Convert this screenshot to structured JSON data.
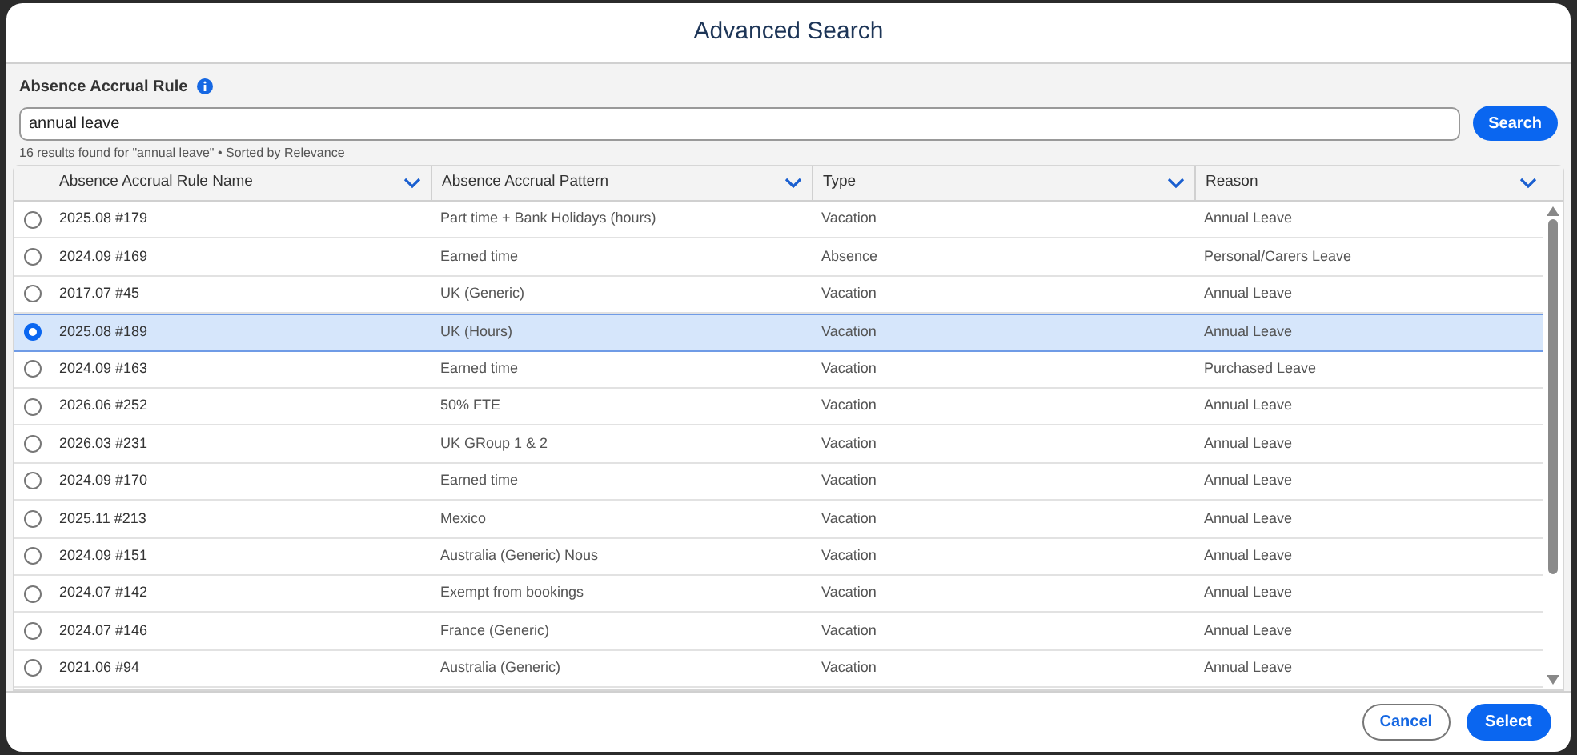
{
  "dialog": {
    "title": "Advanced Search"
  },
  "search": {
    "label": "Absence Accrual Rule",
    "value": "annual leave",
    "button": "Search",
    "summary": "16 results found for \"annual leave\" • Sorted by Relevance"
  },
  "table": {
    "columns": [
      "Absence Accrual Rule Name",
      "Absence Accrual Pattern",
      "Type",
      "Reason"
    ],
    "rows": [
      {
        "selected": false,
        "cells": [
          "2025.08 #179",
          "Part time + Bank Holidays (hours)",
          "Vacation",
          "Annual Leave"
        ]
      },
      {
        "selected": false,
        "cells": [
          "2024.09 #169",
          "Earned time",
          "Absence",
          "Personal/Carers Leave"
        ]
      },
      {
        "selected": false,
        "cells": [
          "2017.07 #45",
          "UK (Generic)",
          "Vacation",
          "Annual Leave"
        ]
      },
      {
        "selected": true,
        "cells": [
          "2025.08 #189",
          "UK (Hours)",
          "Vacation",
          "Annual Leave"
        ]
      },
      {
        "selected": false,
        "cells": [
          "2024.09 #163",
          "Earned time",
          "Vacation",
          "Purchased Leave"
        ]
      },
      {
        "selected": false,
        "cells": [
          "2026.06 #252",
          "50% FTE",
          "Vacation",
          "Annual Leave"
        ]
      },
      {
        "selected": false,
        "cells": [
          "2026.03 #231",
          "UK GRoup 1 & 2",
          "Vacation",
          "Annual Leave"
        ]
      },
      {
        "selected": false,
        "cells": [
          "2024.09 #170",
          "Earned time",
          "Vacation",
          "Annual Leave"
        ]
      },
      {
        "selected": false,
        "cells": [
          "2025.11 #213",
          "Mexico",
          "Vacation",
          "Annual Leave"
        ]
      },
      {
        "selected": false,
        "cells": [
          "2024.09 #151",
          "Australia (Generic) Nous",
          "Vacation",
          "Annual Leave"
        ]
      },
      {
        "selected": false,
        "cells": [
          "2024.07 #142",
          "Exempt from bookings",
          "Vacation",
          "Annual Leave"
        ]
      },
      {
        "selected": false,
        "cells": [
          "2024.07 #146",
          "France (Generic)",
          "Vacation",
          "Annual Leave"
        ]
      },
      {
        "selected": false,
        "cells": [
          "2021.06 #94",
          "Australia (Generic)",
          "Vacation",
          "Annual Leave"
        ]
      }
    ]
  },
  "footer": {
    "buttons": [
      "Cancel",
      "Select"
    ]
  }
}
